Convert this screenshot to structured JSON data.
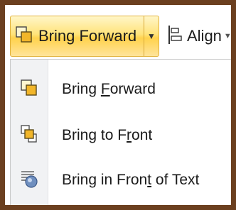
{
  "ribbon": {
    "bring_forward_label": "Bring Forward",
    "bring_forward_icon": "bring-forward-icon",
    "dropdown_icon": "chevron-down-icon",
    "align_label": "Align",
    "align_icon": "align-icon"
  },
  "menu": {
    "items": [
      {
        "pre": "Bring ",
        "key": "F",
        "post": "orward",
        "icon": "bring-forward-icon"
      },
      {
        "pre": "Bring to F",
        "key": "r",
        "post": "ont",
        "icon": "bring-to-front-icon"
      },
      {
        "pre": "Bring in Fron",
        "key": "t",
        "post": " of Text",
        "icon": "bring-in-front-of-text-icon"
      }
    ]
  },
  "colors": {
    "frame": "#6b3f1f",
    "highlight_border": "#e2b23a",
    "highlight_fill": "#ffd24d",
    "gutter": "#f1f2f4"
  }
}
